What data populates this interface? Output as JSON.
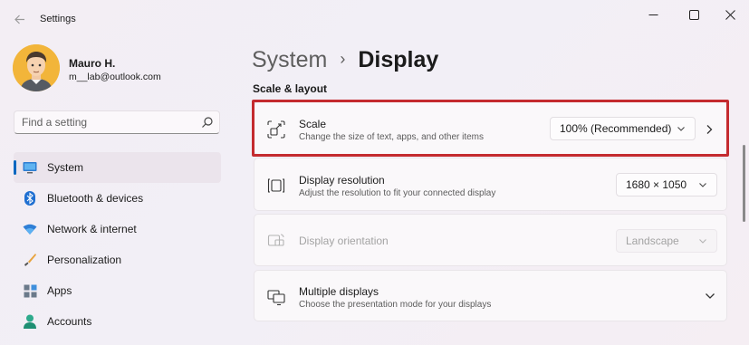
{
  "window": {
    "title": "Settings",
    "back_icon": "back-arrow-icon",
    "controls": [
      "minimize-icon",
      "maximize-icon",
      "close-icon"
    ]
  },
  "profile": {
    "name": "Mauro H.",
    "email": "m__lab@outlook.com"
  },
  "search": {
    "placeholder": "Find a setting",
    "icon": "search-icon"
  },
  "sidebar": {
    "items": [
      {
        "label": "System",
        "icon": "system-icon",
        "active": true
      },
      {
        "label": "Bluetooth & devices",
        "icon": "bluetooth-icon",
        "active": false
      },
      {
        "label": "Network & internet",
        "icon": "wifi-icon",
        "active": false
      },
      {
        "label": "Personalization",
        "icon": "brush-icon",
        "active": false
      },
      {
        "label": "Apps",
        "icon": "apps-icon",
        "active": false
      },
      {
        "label": "Accounts",
        "icon": "accounts-icon",
        "active": false
      }
    ]
  },
  "breadcrumb": {
    "parent": "System",
    "separator": "›",
    "current": "Display"
  },
  "section": {
    "title": "Scale & layout"
  },
  "settings": {
    "scale": {
      "title": "Scale",
      "subtitle": "Change the size of text, apps, and other items",
      "value": "100% (Recommended)",
      "icon": "scale-icon",
      "highlighted": true
    },
    "resolution": {
      "title": "Display resolution",
      "subtitle": "Adjust the resolution to fit your connected display",
      "value": "1680 × 1050",
      "icon": "resolution-icon"
    },
    "orientation": {
      "title": "Display orientation",
      "value": "Landscape",
      "icon": "orientation-icon",
      "disabled": true
    },
    "multiple": {
      "title": "Multiple displays",
      "subtitle": "Choose the presentation mode for your displays",
      "icon": "multiple-displays-icon"
    }
  },
  "colors": {
    "accent": "#0067c0",
    "highlight_border": "#c42b2f"
  }
}
